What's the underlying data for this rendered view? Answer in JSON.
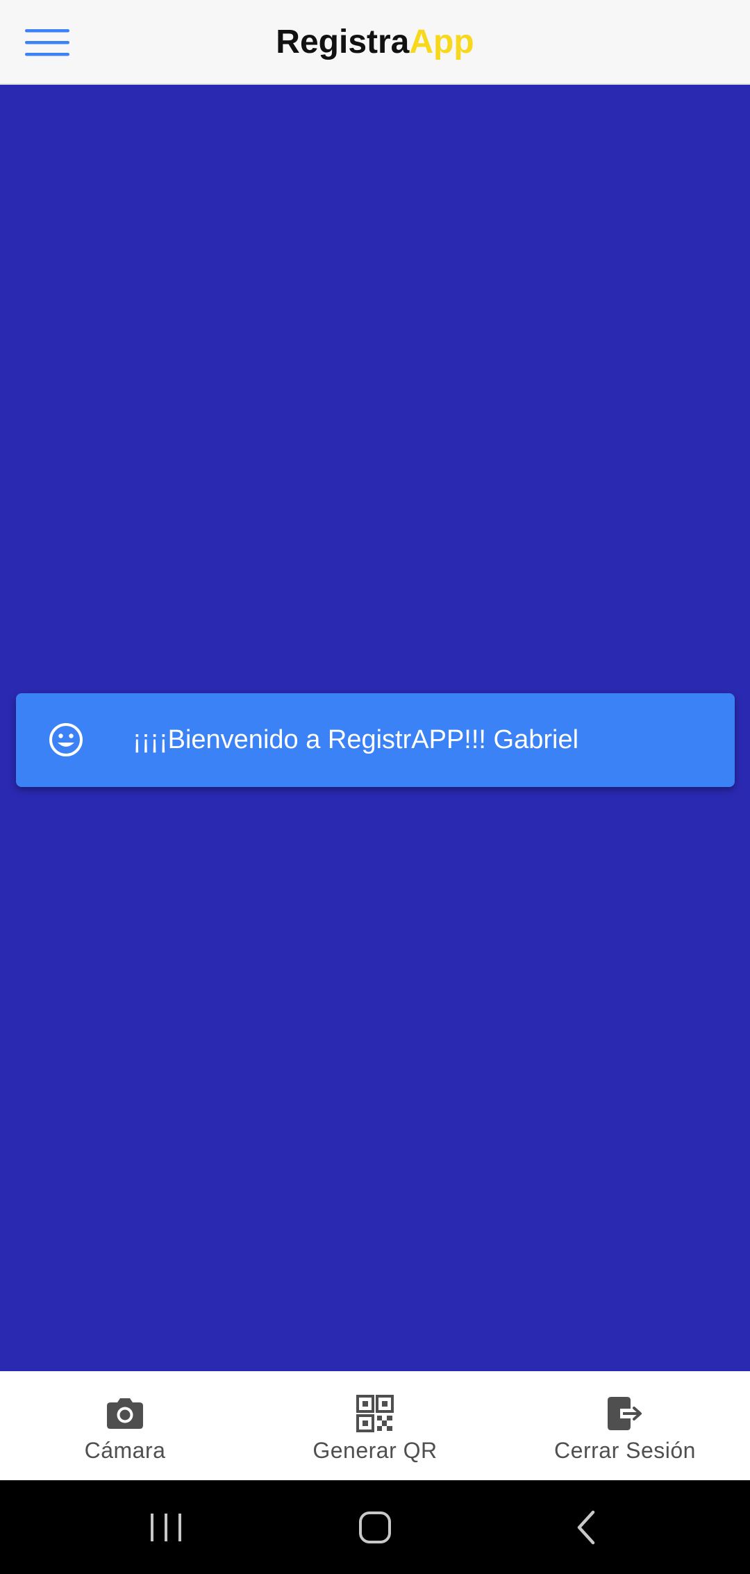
{
  "header": {
    "title_main": "Registra",
    "title_accent": "App",
    "menu_icon": "hamburger-menu-icon"
  },
  "toast": {
    "icon": "smiley-face-icon",
    "message": "¡¡¡¡Bienvenido a RegistrAPP!!! Gabriel"
  },
  "tabs": [
    {
      "icon": "camera-icon",
      "label": "Cámara"
    },
    {
      "icon": "qr-code-icon",
      "label": "Generar QR"
    },
    {
      "icon": "logout-icon",
      "label": "Cerrar Sesión"
    }
  ],
  "system_nav": {
    "recents_icon": "recent-apps-icon",
    "home_icon": "home-icon",
    "back_icon": "back-icon"
  },
  "colors": {
    "background": "#2A29B1",
    "header_bg": "#F7F7F7",
    "accent_yellow": "#F7D81C",
    "toast_bg": "#3B82F6",
    "menu_icon_blue": "#3B82F6",
    "tab_icon_gray": "#4F4F4F",
    "system_bar": "#000000"
  }
}
